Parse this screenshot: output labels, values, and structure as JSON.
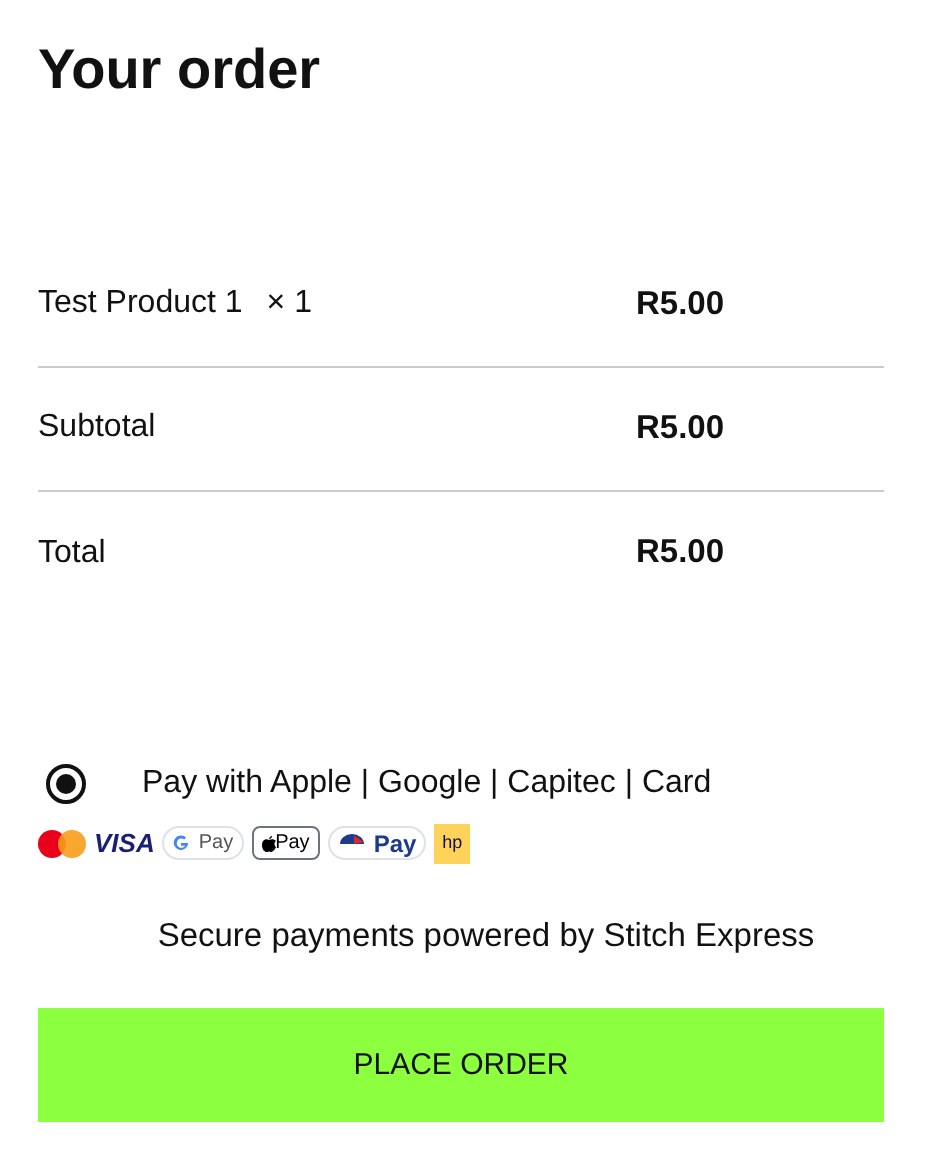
{
  "title": "Your order",
  "rows": [
    {
      "kind": "item",
      "label": "Test Product 1",
      "quantity": "× 1",
      "amount": "R5.00"
    },
    {
      "kind": "total",
      "label": "Subtotal",
      "amount": "R5.00"
    },
    {
      "kind": "total",
      "label": "Total",
      "amount": "R5.00"
    }
  ],
  "payment_methods": [
    {
      "label": "Pay with Apple | Google | Capitec | Card",
      "selected": true
    }
  ],
  "payment_logos": [
    {
      "kind": "mastercard"
    },
    {
      "kind": "visa",
      "text": "VISA"
    },
    {
      "kind": "gpay",
      "text": "Pay"
    },
    {
      "kind": "applepay",
      "text": "Pay"
    },
    {
      "kind": "capitec",
      "text": "Pay"
    },
    {
      "kind": "hp",
      "text": "hp"
    }
  ],
  "secure_note": "Secure payments powered by Stitch Express",
  "place_order_button": "PLACE ORDER"
}
